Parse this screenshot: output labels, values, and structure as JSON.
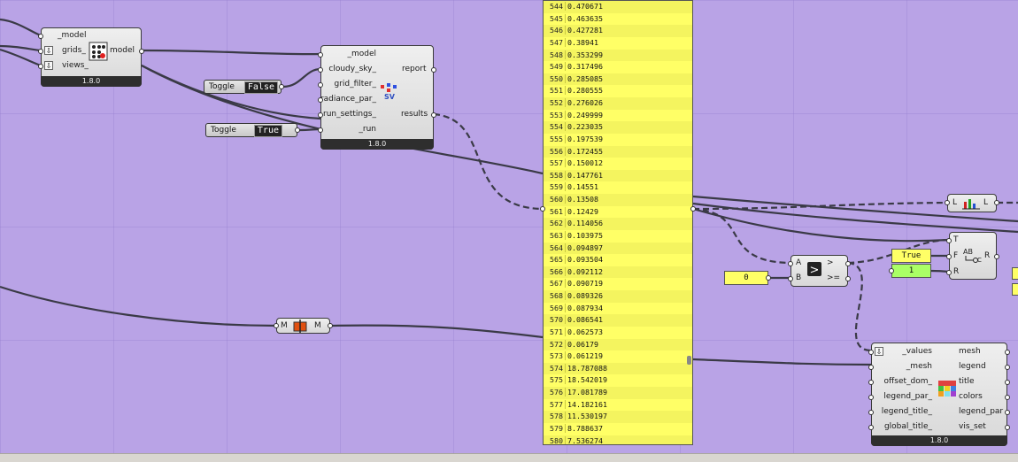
{
  "nodes": {
    "model_comp": {
      "inputs": [
        "_model",
        "grids_",
        "views_"
      ],
      "output": "model",
      "version": "1.8.0"
    },
    "sv_comp": {
      "inputs": [
        "_model",
        "cloudy_sky_",
        "grid_filter_",
        "radiance_par_",
        "run_settings_",
        "_run"
      ],
      "outputs": [
        "report",
        "results"
      ],
      "icon_label": "SV",
      "version": "1.8.0"
    },
    "toggle_false": {
      "label": "Toggle",
      "value": "False"
    },
    "toggle_true": {
      "label": "Toggle",
      "value": "True"
    },
    "list_item": {
      "left": "L",
      "right": "L"
    },
    "merge": {
      "left": "M",
      "right": "M"
    },
    "compare": {
      "inputs": [
        "A",
        "B"
      ],
      "outputs": [
        ">",
        ">="
      ]
    },
    "number_zero": {
      "value": "0"
    },
    "filter": {
      "inputs": [
        "T",
        "F",
        "R"
      ],
      "output": "R"
    },
    "panel_true": {
      "value": "True"
    },
    "panel_one": {
      "value": "1"
    },
    "legend_comp": {
      "inputs": [
        "_values",
        "_mesh",
        "offset_dom_",
        "legend_par_",
        "legend_title_",
        "global_title_"
      ],
      "outputs": [
        "mesh",
        "legend",
        "title",
        "colors",
        "legend_par",
        "vis_set"
      ],
      "version": "1.8.0"
    }
  },
  "panel": {
    "rows": [
      {
        "i": "544",
        "v": "0.470671"
      },
      {
        "i": "545",
        "v": "0.463635"
      },
      {
        "i": "546",
        "v": "0.427281"
      },
      {
        "i": "547",
        "v": "0.38941"
      },
      {
        "i": "548",
        "v": "0.353299"
      },
      {
        "i": "549",
        "v": "0.317496"
      },
      {
        "i": "550",
        "v": "0.285085"
      },
      {
        "i": "551",
        "v": "0.280555"
      },
      {
        "i": "552",
        "v": "0.276026"
      },
      {
        "i": "553",
        "v": "0.249999"
      },
      {
        "i": "554",
        "v": "0.223035"
      },
      {
        "i": "555",
        "v": "0.197539"
      },
      {
        "i": "556",
        "v": "0.172455"
      },
      {
        "i": "557",
        "v": "0.150012"
      },
      {
        "i": "558",
        "v": "0.147761"
      },
      {
        "i": "559",
        "v": "0.14551"
      },
      {
        "i": "560",
        "v": "0.13508"
      },
      {
        "i": "561",
        "v": "0.12429"
      },
      {
        "i": "562",
        "v": "0.114056"
      },
      {
        "i": "563",
        "v": "0.103975"
      },
      {
        "i": "564",
        "v": "0.094897"
      },
      {
        "i": "565",
        "v": "0.093504"
      },
      {
        "i": "566",
        "v": "0.092112"
      },
      {
        "i": "567",
        "v": "0.090719"
      },
      {
        "i": "568",
        "v": "0.089326"
      },
      {
        "i": "569",
        "v": "0.087934"
      },
      {
        "i": "570",
        "v": "0.086541"
      },
      {
        "i": "571",
        "v": "0.062573"
      },
      {
        "i": "572",
        "v": "0.06179"
      },
      {
        "i": "573",
        "v": "0.061219"
      },
      {
        "i": "574",
        "v": "18.787088"
      },
      {
        "i": "575",
        "v": "18.542019"
      },
      {
        "i": "576",
        "v": "17.081789"
      },
      {
        "i": "577",
        "v": "14.182161"
      },
      {
        "i": "578",
        "v": "11.530197"
      },
      {
        "i": "579",
        "v": "8.788637"
      },
      {
        "i": "580",
        "v": "7.536274"
      }
    ]
  },
  "colors": {
    "canvas": "#b9a3e6",
    "panel": "#ffff66",
    "panel_green": "#aaff66",
    "wire": "#3a3a46"
  }
}
